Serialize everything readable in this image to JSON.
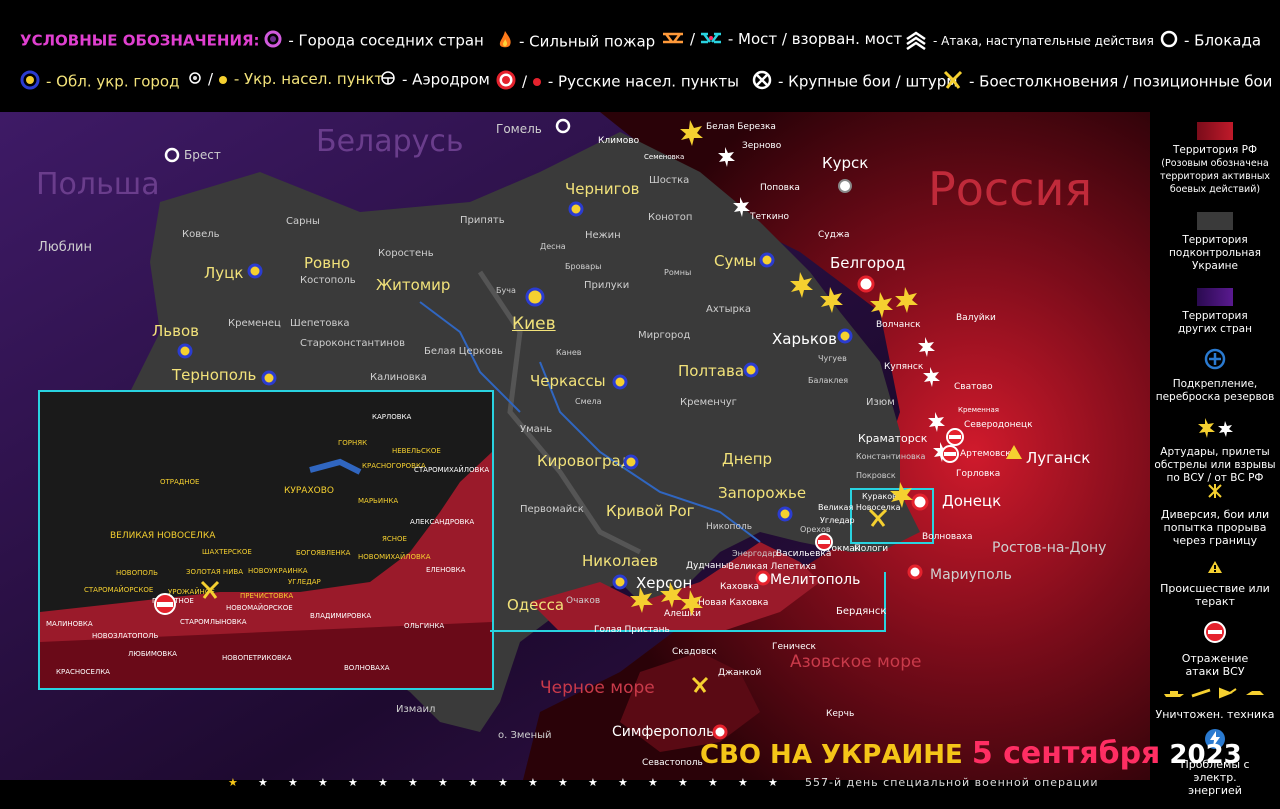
{
  "legend_top": {
    "title": "УСЛОВНЫЕ ОБОЗНАЧЕНИЯ:",
    "neighbor_cities": "- Города соседних стран",
    "big_fire": "- Сильный пожар",
    "bridge": "- Мост / взорван. мост",
    "attack": "- Атака, наступательные действия",
    "blockade": "- Блокада",
    "oblast_city": "- Обл. укр. город",
    "ukr_settlement": "- Укр. насел. пункт",
    "airfield": "- Аэродром",
    "russian_settlements": "- Русские  насел. пункты",
    "major_battles": "- Крупные бои / штурм",
    "clashes": "- Боестолкновения / позиционные бои",
    "slash": "/"
  },
  "sidebar": {
    "rf_territory": "Территория РФ",
    "rf_note": "(Розовым обозначена территория активных боевых действий)",
    "ukr_territory": "Территория подконтрольная Украине",
    "other_territory": "Территория других стран",
    "reinforcement": "Подкрепление, переброска резервов",
    "artillery": "Артудары, прилеты обстрелы или взрывы по ВСУ  /  от ВС РФ",
    "diversion": "Диверсия, бои или попытка прорыва через границу",
    "incident": "Происшествие или теракт",
    "repel": "Отражение атаки ВСУ",
    "destroyed": "Уничтожен. техника",
    "power": "Проблемы с электр. энергией"
  },
  "colors": {
    "accent": "#ff2e63",
    "yellow": "#f5c518",
    "rf": "#7a0c1a",
    "ukraine": "#3a3a3a",
    "other": "#3a1450",
    "inset_border": "#29d3e0"
  },
  "map": {
    "countries": {
      "belarus": "Беларусь",
      "poland": "Польша",
      "russia": "Россия"
    },
    "seas": {
      "black": "Черное море",
      "azov": "Азовское море"
    },
    "oblast_cities": [
      "Киев",
      "Чернигов",
      "Сумы",
      "Харьков",
      "Луцк",
      "Ровно",
      "Житомир",
      "Львов",
      "Тернополь",
      "Черкассы",
      "Полтава",
      "Кировоград",
      "Днепр",
      "Запорожье",
      "Кривой Рог",
      "Николаев",
      "Херсон",
      "Одесса"
    ],
    "neighbor_cities": [
      "Брест",
      "Люблин",
      "Гомель",
      "Курск",
      "Белгород",
      "Луганск",
      "Донецк",
      "Ростов-на-Дону",
      "Мариуполь",
      "Мелитополь",
      "Симферополь"
    ],
    "towns": [
      "Ковель",
      "Сарны",
      "Припять",
      "Костополь",
      "Коростень",
      "Кременец",
      "Шепетовка",
      "Староконстантинов",
      "Белая Церковь",
      "Калиновка",
      "Канев",
      "Смела",
      "Умань",
      "Первомайск",
      "Кременчуг",
      "Миргород",
      "Прилуки",
      "Ромны",
      "Конотоп",
      "Шостка",
      "Нежин",
      "Десна",
      "Бровары",
      "Буча",
      "Ахтырка",
      "Чугуев",
      "Балаклея",
      "Изюм",
      "Краматорск",
      "Константиновка",
      "Покровск",
      "Никополь",
      "Энергодар",
      "Васильевка",
      "Орехов",
      "Очаков",
      "Голая Пристань",
      "Алешки",
      "Новая Каховка",
      "Дудчаны",
      "Великая Лепетиха",
      "Каховка",
      "Скадовск",
      "Геническ",
      "Джанкой",
      "Бердянск",
      "Токмак",
      "Пологи",
      "Волноваха",
      "Измаил",
      "о. Зменый",
      "Севастополь",
      "Керчь",
      "Суджа",
      "Теткино",
      "Поповка",
      "Зерново",
      "Белая Березка",
      "Климово",
      "Семеновка",
      "Валуйки",
      "Сватово",
      "Кременная",
      "Северодонецк",
      "Артемовск",
      "Горловка",
      "Купянск",
      "Волчанск",
      "Великая Новоселка",
      "Угледар",
      "Кураково",
      "Керч"
    ],
    "inset_labels": [
      "КАРЛОВКА",
      "ГОРНЯК",
      "НЕВЕЛЬСКОЕ",
      "КРАСНОГОРОВКА",
      "СТАРОМИХАЙЛОВКА",
      "КУРАХОВО",
      "МАРЬИНКА",
      "АЛЕКСАНДРОВКА",
      "ВЕЛИКАЯ НОВОСЕЛКА",
      "ШАХТЕРСКОЕ",
      "БОГОЯВЛЕНКА",
      "НОВОМИХАЙЛОВКА",
      "ЗОЛОТАЯ НИВА",
      "НОВОУКРАИНКА",
      "УГЛЕДАР",
      "СТАРОМАЙОРСКОЕ",
      "УРОЖАЙНОЕ",
      "ПРЕЧИСТОВКА",
      "НОВОМАЙОРСКОЕ",
      "ВЛАДИМИРОВКА",
      "ОЛЬГИНКА",
      "ЕЛЕНОВКА",
      "ВОЛНОВАХА",
      "ПРИЮТНОЕ",
      "НОВОЗЛАТОПОЛЬ",
      "СТАРОМЛЫНОВКА",
      "НОВОПЕТРИКОВКА",
      "ЛЮБИМОВКА",
      "МАЛИНОВКА",
      "КРАСНОСЕЛКА",
      "НОВОПОЛЬ",
      "ОТРАДНОЕ",
      "ЯСНОЕ"
    ]
  },
  "footer": {
    "title": "СВО НА УКРАИНЕ",
    "date": "5 сентября",
    "year": "2023",
    "subtitle": "557-й день специальной военной операции"
  }
}
